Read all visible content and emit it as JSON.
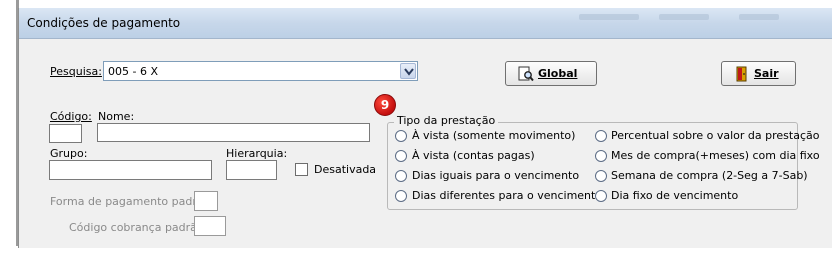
{
  "window": {
    "title": "Condições de pagamento"
  },
  "search": {
    "label": "Pesquisa:",
    "value": "005 - 6 X"
  },
  "buttons": {
    "global_label": "Global",
    "exit_label": "Sair"
  },
  "fields": {
    "codigo_label": "Código:",
    "nome_label": "Nome:",
    "grupo_label": "Grupo:",
    "hierarquia_label": "Hierarquia:",
    "desativada_label": "Desativada",
    "forma_pagamento_label": "Forma de pagamento padrão:",
    "codigo_cobranca_label": "Código cobrança padrão:"
  },
  "badge": {
    "value": "9"
  },
  "tipo_prestacao": {
    "title": "Tipo da prestação",
    "left": [
      "À vista  (somente movimento)",
      "À vista  (contas pagas)",
      "Dias iguais para o vencimento",
      "Dias diferentes para o vencimento"
    ],
    "right": [
      "Percentual sobre o valor da prestação",
      "Mes de compra(+meses) com dia fixo",
      "Semana de compra (2-Seg a 7-Sab)",
      "Dia fixo de vencimento"
    ]
  },
  "colors": {
    "badge": "#d81b1b",
    "titlebar": "#c7d7ea",
    "window_bg": "#f0f0f0"
  },
  "icons": {
    "global": "preview-magnifier-icon",
    "exit": "door-exit-icon",
    "dropdown": "chevron-down-icon"
  }
}
